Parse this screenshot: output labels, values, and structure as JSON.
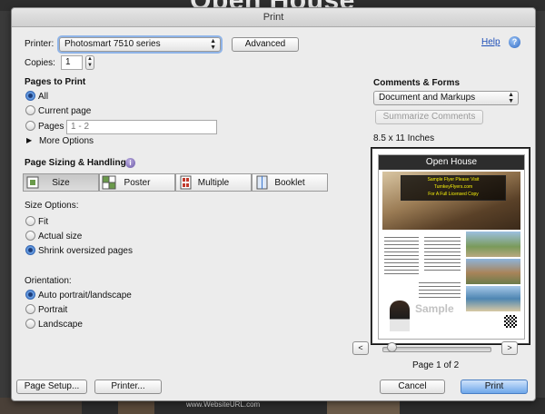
{
  "window": {
    "title": "Print",
    "background_heading": "Open House",
    "background_url": "www.WebsiteURL.com"
  },
  "printer": {
    "label": "Printer:",
    "value": "Photosmart 7510 series",
    "advanced_label": "Advanced",
    "help_label": "Help"
  },
  "copies": {
    "label": "Copies:",
    "value": "1"
  },
  "pages": {
    "heading": "Pages to Print",
    "options": [
      {
        "label": "All",
        "selected": true
      },
      {
        "label": "Current page",
        "selected": false
      },
      {
        "label": "Pages",
        "selected": false
      }
    ],
    "range_placeholder": "1 - 2",
    "more_options_label": "More Options"
  },
  "sizing": {
    "heading": "Page Sizing & Handling",
    "modes": [
      {
        "label": "Size",
        "icon": "size-icon",
        "active": true
      },
      {
        "label": "Poster",
        "icon": "poster-icon",
        "active": false
      },
      {
        "label": "Multiple",
        "icon": "multiple-icon",
        "active": false
      },
      {
        "label": "Booklet",
        "icon": "booklet-icon",
        "active": false
      }
    ],
    "size_options_label": "Size Options:",
    "size_options": [
      {
        "label": "Fit",
        "selected": false
      },
      {
        "label": "Actual size",
        "selected": false
      },
      {
        "label": "Shrink oversized pages",
        "selected": true
      }
    ],
    "orientation_label": "Orientation:",
    "orientation_options": [
      {
        "label": "Auto portrait/landscape",
        "selected": true
      },
      {
        "label": "Portrait",
        "selected": false
      },
      {
        "label": "Landscape",
        "selected": false
      }
    ]
  },
  "comments": {
    "heading": "Comments & Forms",
    "value": "Document and Markups",
    "summarize_label": "Summarize Comments"
  },
  "preview": {
    "paper_size": "8.5 x 11 Inches",
    "flyer_title": "Open House",
    "flyer_banner": [
      "Sample Flyer Please Visit",
      "TurnkeyFlyers.com",
      "For A Full Licensed Copy"
    ],
    "flyer_watermark": "Sample",
    "page_indicator": "Page 1 of 2",
    "prev_label": "<",
    "next_label": ">",
    "zoom_fraction": 0.05
  },
  "buttons": {
    "page_setup": "Page Setup...",
    "printer": "Printer...",
    "cancel": "Cancel",
    "print": "Print"
  },
  "colors": {
    "accent": "#3d78cf",
    "link": "#1e4fb8"
  }
}
